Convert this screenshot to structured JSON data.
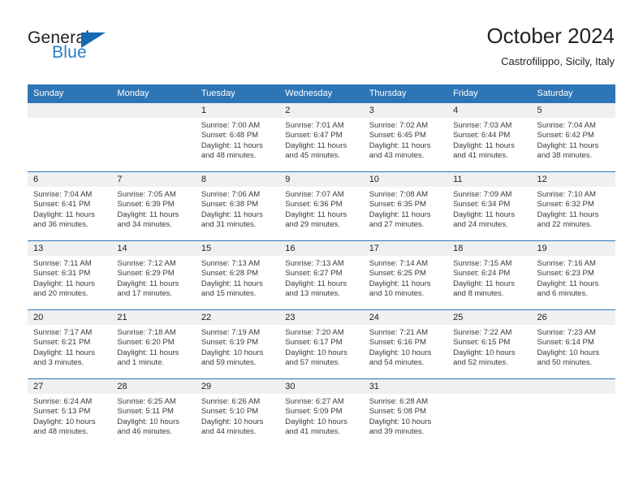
{
  "brand": {
    "name_top": "General",
    "name_bottom": "Blue",
    "triangle_color": "#1668b0",
    "blue_color": "#2b7cc4"
  },
  "header": {
    "title": "October 2024",
    "subtitle": "Castrofilippo, Sicily, Italy"
  },
  "theme": {
    "header_blue": "#2e75b6",
    "daynum_bg": "#f0f0f0"
  },
  "weekday_headers": [
    "Sunday",
    "Monday",
    "Tuesday",
    "Wednesday",
    "Thursday",
    "Friday",
    "Saturday"
  ],
  "weeks": [
    [
      {
        "empty": true,
        "day": ""
      },
      {
        "empty": true,
        "day": ""
      },
      {
        "day": "1",
        "sunrise": "Sunrise: 7:00 AM",
        "sunset": "Sunset: 6:48 PM",
        "daylight_1": "Daylight: 11 hours",
        "daylight_2": "and 48 minutes."
      },
      {
        "day": "2",
        "sunrise": "Sunrise: 7:01 AM",
        "sunset": "Sunset: 6:47 PM",
        "daylight_1": "Daylight: 11 hours",
        "daylight_2": "and 45 minutes."
      },
      {
        "day": "3",
        "sunrise": "Sunrise: 7:02 AM",
        "sunset": "Sunset: 6:45 PM",
        "daylight_1": "Daylight: 11 hours",
        "daylight_2": "and 43 minutes."
      },
      {
        "day": "4",
        "sunrise": "Sunrise: 7:03 AM",
        "sunset": "Sunset: 6:44 PM",
        "daylight_1": "Daylight: 11 hours",
        "daylight_2": "and 41 minutes."
      },
      {
        "day": "5",
        "sunrise": "Sunrise: 7:04 AM",
        "sunset": "Sunset: 6:42 PM",
        "daylight_1": "Daylight: 11 hours",
        "daylight_2": "and 38 minutes."
      }
    ],
    [
      {
        "day": "6",
        "sunrise": "Sunrise: 7:04 AM",
        "sunset": "Sunset: 6:41 PM",
        "daylight_1": "Daylight: 11 hours",
        "daylight_2": "and 36 minutes."
      },
      {
        "day": "7",
        "sunrise": "Sunrise: 7:05 AM",
        "sunset": "Sunset: 6:39 PM",
        "daylight_1": "Daylight: 11 hours",
        "daylight_2": "and 34 minutes."
      },
      {
        "day": "8",
        "sunrise": "Sunrise: 7:06 AM",
        "sunset": "Sunset: 6:38 PM",
        "daylight_1": "Daylight: 11 hours",
        "daylight_2": "and 31 minutes."
      },
      {
        "day": "9",
        "sunrise": "Sunrise: 7:07 AM",
        "sunset": "Sunset: 6:36 PM",
        "daylight_1": "Daylight: 11 hours",
        "daylight_2": "and 29 minutes."
      },
      {
        "day": "10",
        "sunrise": "Sunrise: 7:08 AM",
        "sunset": "Sunset: 6:35 PM",
        "daylight_1": "Daylight: 11 hours",
        "daylight_2": "and 27 minutes."
      },
      {
        "day": "11",
        "sunrise": "Sunrise: 7:09 AM",
        "sunset": "Sunset: 6:34 PM",
        "daylight_1": "Daylight: 11 hours",
        "daylight_2": "and 24 minutes."
      },
      {
        "day": "12",
        "sunrise": "Sunrise: 7:10 AM",
        "sunset": "Sunset: 6:32 PM",
        "daylight_1": "Daylight: 11 hours",
        "daylight_2": "and 22 minutes."
      }
    ],
    [
      {
        "day": "13",
        "sunrise": "Sunrise: 7:11 AM",
        "sunset": "Sunset: 6:31 PM",
        "daylight_1": "Daylight: 11 hours",
        "daylight_2": "and 20 minutes."
      },
      {
        "day": "14",
        "sunrise": "Sunrise: 7:12 AM",
        "sunset": "Sunset: 6:29 PM",
        "daylight_1": "Daylight: 11 hours",
        "daylight_2": "and 17 minutes."
      },
      {
        "day": "15",
        "sunrise": "Sunrise: 7:13 AM",
        "sunset": "Sunset: 6:28 PM",
        "daylight_1": "Daylight: 11 hours",
        "daylight_2": "and 15 minutes."
      },
      {
        "day": "16",
        "sunrise": "Sunrise: 7:13 AM",
        "sunset": "Sunset: 6:27 PM",
        "daylight_1": "Daylight: 11 hours",
        "daylight_2": "and 13 minutes."
      },
      {
        "day": "17",
        "sunrise": "Sunrise: 7:14 AM",
        "sunset": "Sunset: 6:25 PM",
        "daylight_1": "Daylight: 11 hours",
        "daylight_2": "and 10 minutes."
      },
      {
        "day": "18",
        "sunrise": "Sunrise: 7:15 AM",
        "sunset": "Sunset: 6:24 PM",
        "daylight_1": "Daylight: 11 hours",
        "daylight_2": "and 8 minutes."
      },
      {
        "day": "19",
        "sunrise": "Sunrise: 7:16 AM",
        "sunset": "Sunset: 6:23 PM",
        "daylight_1": "Daylight: 11 hours",
        "daylight_2": "and 6 minutes."
      }
    ],
    [
      {
        "day": "20",
        "sunrise": "Sunrise: 7:17 AM",
        "sunset": "Sunset: 6:21 PM",
        "daylight_1": "Daylight: 11 hours",
        "daylight_2": "and 3 minutes."
      },
      {
        "day": "21",
        "sunrise": "Sunrise: 7:18 AM",
        "sunset": "Sunset: 6:20 PM",
        "daylight_1": "Daylight: 11 hours",
        "daylight_2": "and 1 minute."
      },
      {
        "day": "22",
        "sunrise": "Sunrise: 7:19 AM",
        "sunset": "Sunset: 6:19 PM",
        "daylight_1": "Daylight: 10 hours",
        "daylight_2": "and 59 minutes."
      },
      {
        "day": "23",
        "sunrise": "Sunrise: 7:20 AM",
        "sunset": "Sunset: 6:17 PM",
        "daylight_1": "Daylight: 10 hours",
        "daylight_2": "and 57 minutes."
      },
      {
        "day": "24",
        "sunrise": "Sunrise: 7:21 AM",
        "sunset": "Sunset: 6:16 PM",
        "daylight_1": "Daylight: 10 hours",
        "daylight_2": "and 54 minutes."
      },
      {
        "day": "25",
        "sunrise": "Sunrise: 7:22 AM",
        "sunset": "Sunset: 6:15 PM",
        "daylight_1": "Daylight: 10 hours",
        "daylight_2": "and 52 minutes."
      },
      {
        "day": "26",
        "sunrise": "Sunrise: 7:23 AM",
        "sunset": "Sunset: 6:14 PM",
        "daylight_1": "Daylight: 10 hours",
        "daylight_2": "and 50 minutes."
      }
    ],
    [
      {
        "day": "27",
        "sunrise": "Sunrise: 6:24 AM",
        "sunset": "Sunset: 5:13 PM",
        "daylight_1": "Daylight: 10 hours",
        "daylight_2": "and 48 minutes."
      },
      {
        "day": "28",
        "sunrise": "Sunrise: 6:25 AM",
        "sunset": "Sunset: 5:11 PM",
        "daylight_1": "Daylight: 10 hours",
        "daylight_2": "and 46 minutes."
      },
      {
        "day": "29",
        "sunrise": "Sunrise: 6:26 AM",
        "sunset": "Sunset: 5:10 PM",
        "daylight_1": "Daylight: 10 hours",
        "daylight_2": "and 44 minutes."
      },
      {
        "day": "30",
        "sunrise": "Sunrise: 6:27 AM",
        "sunset": "Sunset: 5:09 PM",
        "daylight_1": "Daylight: 10 hours",
        "daylight_2": "and 41 minutes."
      },
      {
        "day": "31",
        "sunrise": "Sunrise: 6:28 AM",
        "sunset": "Sunset: 5:08 PM",
        "daylight_1": "Daylight: 10 hours",
        "daylight_2": "and 39 minutes."
      },
      {
        "empty": true,
        "day": ""
      },
      {
        "empty": true,
        "day": ""
      }
    ]
  ]
}
